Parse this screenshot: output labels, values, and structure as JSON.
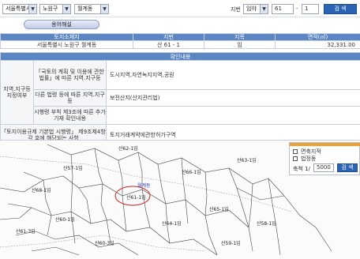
{
  "search": {
    "city": "서울특별시",
    "district": "노원구",
    "dong": "월계동",
    "lot_label": "지번",
    "lot_type": "임야",
    "main_no": "61",
    "sub_no": "1",
    "search_button": "검 색"
  },
  "help_button": "용어해설",
  "land_table": {
    "headers": [
      "토지소재지",
      "지번",
      "지목",
      "면적(㎡)"
    ],
    "row": {
      "location": "서울특별시 노원구 월계동",
      "lot_no": "산 61 - 1",
      "category": "임",
      "area": "32,331.00"
    }
  },
  "confirm": {
    "band_title": "확인내용",
    "zone_label": "지역.지구등 지정여부",
    "rows": [
      {
        "label": "「국토의 계획 및 이용에 관한 법률」에 따른 지역.지구등",
        "value": "도시지역,자연녹지지역,공원"
      },
      {
        "label": "다른 법령 등에 따른 지역.지구등",
        "value": "보전산지(산지관리법)"
      },
      {
        "label": "시행령 부칙 제3조에 따른 추가기재 확인내용",
        "value": ""
      }
    ],
    "bylaw_label": "「토지이용규제 기본법 시행령」 제9조제4항 각 호에 해당되는 사항",
    "bylaw_value": "토지거래계약에관한허가구역"
  },
  "legend": {
    "items": [
      "면축지적",
      "법정동"
    ],
    "scale_label": "축척 1/",
    "scale_value": "5000",
    "search_button": "검 색"
  },
  "map_labels": [
    "산61-1임",
    "월계동",
    "산68-1임",
    "산60-1임",
    "산66-1임",
    "산65-1임",
    "산62-1임",
    "산63-1임",
    "산64-1임",
    "산61-3임",
    "산60-3임",
    "산59-1임",
    "산58-1임",
    "산57-1임"
  ],
  "colors": {
    "header_blue": "#5a86c4",
    "button_blue": "#2a64b3",
    "highlight_red": "#d22020",
    "legend_orange": "#f0a030"
  }
}
